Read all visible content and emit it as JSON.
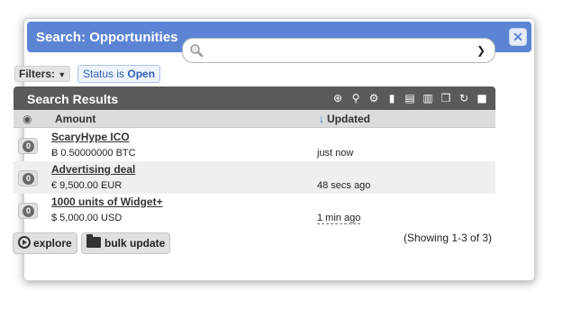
{
  "window": {
    "title": "Search: Opportunities"
  },
  "search": {
    "placeholder": "",
    "value": ""
  },
  "filters": {
    "label": "Filters:",
    "chip_prefix": "Status is",
    "chip_value": "Open"
  },
  "results": {
    "title": "Search Results",
    "toolbar_icons": [
      "add-icon",
      "search-icon",
      "settings-icon",
      "chart-icon",
      "export-icon",
      "import-icon",
      "copy-icon",
      "refresh-icon",
      "stop-icon"
    ],
    "columns": {
      "amount": "Amount",
      "updated": "Updated"
    },
    "rows": [
      {
        "badge": "0",
        "name": "ScaryHype ICO",
        "amount": "Ƀ 0.50000000 BTC",
        "updated": "just now"
      },
      {
        "badge": "0",
        "name": "Advertising deal",
        "amount": "€ 9,500.00 EUR",
        "updated": "48 secs ago"
      },
      {
        "badge": "0",
        "name": "1000 units of Widget+",
        "amount": "$ 5,000.00 USD",
        "updated": "1 min ago"
      }
    ],
    "showing": "(Showing 1-3 of 3)"
  },
  "actions": {
    "explore": "explore",
    "bulk_update": "bulk update"
  },
  "colors": {
    "titlebar": "#5b85d4",
    "header": "#5a5a5a",
    "sort": "#2f6bd8",
    "chip": "#2f5fb3"
  }
}
